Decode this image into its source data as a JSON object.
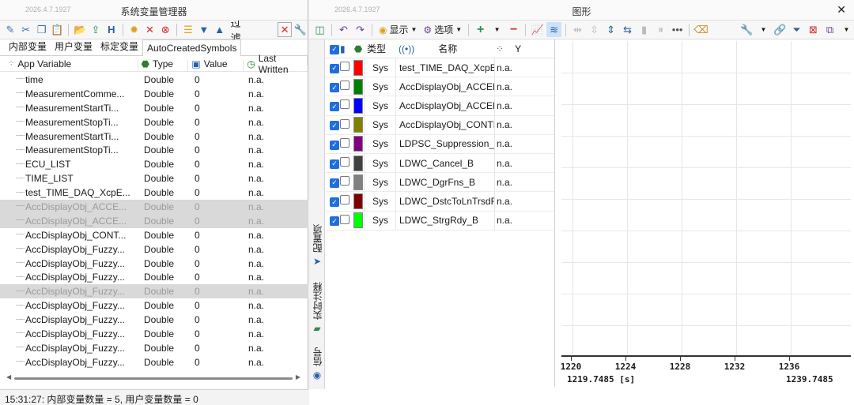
{
  "left_window": {
    "version": "2026.4.7.1927",
    "title": "系统变量管理器",
    "toolbar": {
      "filter_label": "过滤"
    },
    "tabs": [
      "内部变量",
      "用户变量",
      "标定变量",
      "AutoCreatedSymbols"
    ],
    "columns": {
      "name": "App Variable",
      "type": "Type",
      "value": "Value",
      "last": "Last Written"
    },
    "rows": [
      {
        "name": "time",
        "type": "Double",
        "value": "0",
        "last": "n.a.",
        "selected": false
      },
      {
        "name": "MeasurementComme...",
        "type": "Double",
        "value": "0",
        "last": "n.a.",
        "selected": false
      },
      {
        "name": "MeasurementStartTi...",
        "type": "Double",
        "value": "0",
        "last": "n.a.",
        "selected": false
      },
      {
        "name": "MeasurementStopTi...",
        "type": "Double",
        "value": "0",
        "last": "n.a.",
        "selected": false
      },
      {
        "name": "MeasurementStartTi...",
        "type": "Double",
        "value": "0",
        "last": "n.a.",
        "selected": false
      },
      {
        "name": "MeasurementStopTi...",
        "type": "Double",
        "value": "0",
        "last": "n.a.",
        "selected": false
      },
      {
        "name": "ECU_LIST",
        "type": "Double",
        "value": "0",
        "last": "n.a.",
        "selected": false
      },
      {
        "name": "TIME_LIST",
        "type": "Double",
        "value": "0",
        "last": "n.a.",
        "selected": false
      },
      {
        "name": "test_TIME_DAQ_XcpE...",
        "type": "Double",
        "value": "0",
        "last": "n.a.",
        "selected": false
      },
      {
        "name": "AccDisplayObj_ACCE...",
        "type": "Double",
        "value": "0",
        "last": "n.a.",
        "selected": true
      },
      {
        "name": "AccDisplayObj_ACCE...",
        "type": "Double",
        "value": "0",
        "last": "n.a.",
        "selected": true
      },
      {
        "name": "AccDisplayObj_CONT...",
        "type": "Double",
        "value": "0",
        "last": "n.a.",
        "selected": false
      },
      {
        "name": "AccDisplayObj_Fuzzy...",
        "type": "Double",
        "value": "0",
        "last": "n.a.",
        "selected": false
      },
      {
        "name": "AccDisplayObj_Fuzzy...",
        "type": "Double",
        "value": "0",
        "last": "n.a.",
        "selected": false
      },
      {
        "name": "AccDisplayObj_Fuzzy...",
        "type": "Double",
        "value": "0",
        "last": "n.a.",
        "selected": false
      },
      {
        "name": "AccDisplayObj_Fuzzy...",
        "type": "Double",
        "value": "0",
        "last": "n.a.",
        "selected": true
      },
      {
        "name": "AccDisplayObj_Fuzzy...",
        "type": "Double",
        "value": "0",
        "last": "n.a.",
        "selected": false
      },
      {
        "name": "AccDisplayObj_Fuzzy...",
        "type": "Double",
        "value": "0",
        "last": "n.a.",
        "selected": false
      },
      {
        "name": "AccDisplayObj_Fuzzy...",
        "type": "Double",
        "value": "0",
        "last": "n.a.",
        "selected": false
      },
      {
        "name": "AccDisplayObj_Fuzzy...",
        "type": "Double",
        "value": "0",
        "last": "n.a.",
        "selected": false
      },
      {
        "name": "AccDisplayObj_Fuzzy...",
        "type": "Double",
        "value": "0",
        "last": "n.a.",
        "selected": false
      }
    ],
    "status": "15:31:27: 内部变量数量 = 5, 用户变量数量 = 0"
  },
  "right_window": {
    "version": "2026.4.7.1927",
    "title": "图形",
    "toolbar": {
      "display_label": "显示",
      "options_label": "选项"
    },
    "side_tabs": {
      "config": "配置项",
      "realtime": "实时注释",
      "signal": "信号"
    },
    "signal_columns": {
      "type": "类型",
      "name": "名称",
      "y": "Y"
    },
    "signals": [
      {
        "color": "#ff0000",
        "type": "Sys",
        "name": "test_TIME_DAQ_XcpEve",
        "y": "n.a."
      },
      {
        "color": "#008000",
        "type": "Sys",
        "name": "AccDisplayObj_ACCEL_F",
        "y": "n.a."
      },
      {
        "color": "#0000ff",
        "type": "Sys",
        "name": "AccDisplayObj_ACCEL_F",
        "y": "n.a."
      },
      {
        "color": "#808000",
        "type": "Sys",
        "name": "AccDisplayObj_CONTRO",
        "y": "n.a."
      },
      {
        "color": "#800080",
        "type": "Sys",
        "name": "LDPSC_Suppression_B",
        "y": "n.a."
      },
      {
        "color": "#404040",
        "type": "Sys",
        "name": "LDWC_Cancel_B",
        "y": "n.a."
      },
      {
        "color": "#808080",
        "type": "Sys",
        "name": "LDWC_DgrFns_B",
        "y": "n.a."
      },
      {
        "color": "#800000",
        "type": "Sys",
        "name": "LDWC_DstcToLnTrsdRi_B",
        "y": "n.a."
      },
      {
        "color": "#00ff00",
        "type": "Sys",
        "name": "LDWC_StrgRdy_B",
        "y": "n.a."
      }
    ],
    "x_axis": {
      "ticks": [
        "1220",
        "1224",
        "1228",
        "1232",
        "1236"
      ],
      "range_start": "1219.7485 [s]",
      "range_end": "1239.7485"
    }
  }
}
